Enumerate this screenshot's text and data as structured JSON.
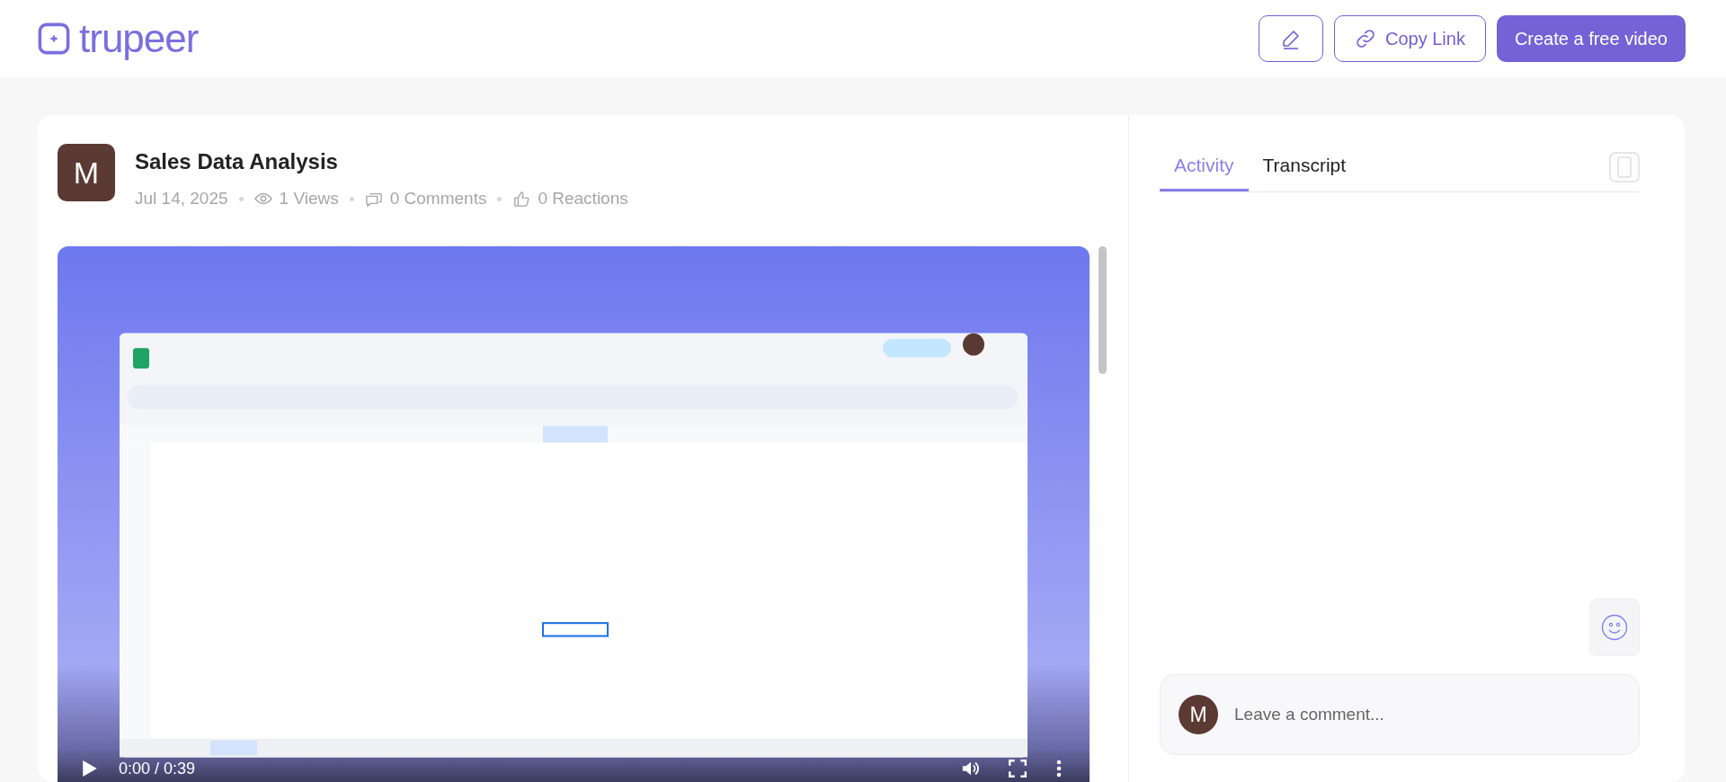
{
  "header": {
    "logo": "trupeer",
    "buttons": [
      {
        "kind": "icon"
      },
      {
        "kind": "link",
        "label": "Copy Link"
      },
      {
        "kind": "primary",
        "label": "Create a free video"
      }
    ]
  },
  "video": {
    "avatar": "M",
    "title": "Sales Data Analysis",
    "meta": [
      {
        "kind": "date",
        "text": "Jul 14, 2025"
      },
      {
        "kind": "views",
        "text": "1 Views"
      },
      {
        "kind": "comments",
        "text": "0 Comments"
      },
      {
        "kind": "reactions",
        "text": "0 Reactions"
      }
    ],
    "player": {
      "time": "0:00 / 0:39"
    }
  },
  "side_panel": {
    "tabs": [
      {
        "label": "Activity",
        "selected": true
      },
      {
        "label": "Transcript",
        "selected": false
      }
    ],
    "comment": {
      "avatar": "M",
      "placeholder": "Leave a comment..."
    }
  }
}
